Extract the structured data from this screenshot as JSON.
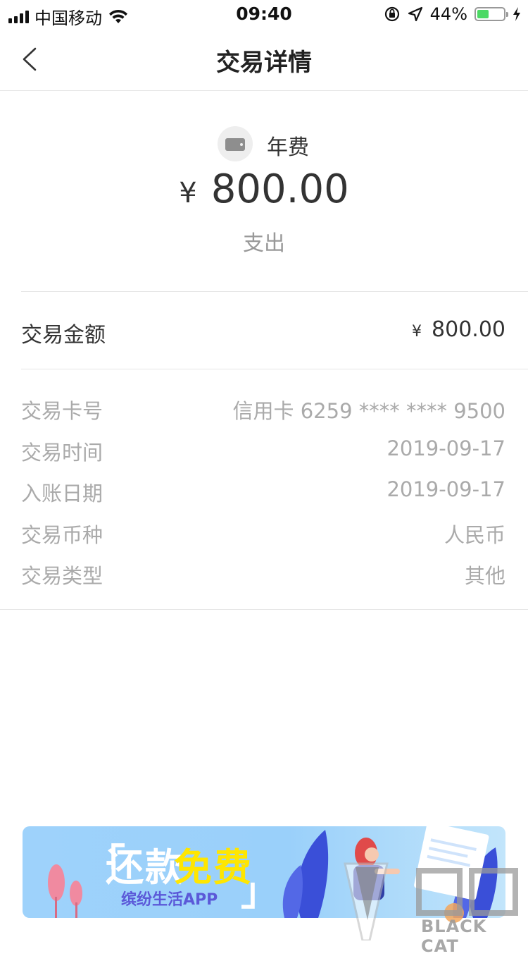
{
  "status_bar": {
    "carrier": "中国移动",
    "time": "09:40",
    "battery_percent": "44%",
    "battery_level": 0.44,
    "icons": [
      "signal-icon",
      "wifi-icon",
      "orientation-lock-icon",
      "location-icon",
      "battery-icon",
      "charging-icon"
    ]
  },
  "nav": {
    "title": "交易详情",
    "back_icon": "chevron-left-icon"
  },
  "summary": {
    "icon": "wallet-icon",
    "label": "年费",
    "currency_symbol": "¥",
    "amount": "800.00",
    "direction": "支出"
  },
  "amount_row": {
    "label": "交易金额",
    "currency_symbol": "¥",
    "value": "800.00"
  },
  "details": [
    {
      "label": "交易卡号",
      "value": "信用卡 6259 **** **** 9500"
    },
    {
      "label": "交易时间",
      "value": "2019-09-17"
    },
    {
      "label": "入账日期",
      "value": "2019-09-17"
    },
    {
      "label": "交易币种",
      "value": "人民币"
    },
    {
      "label": "交易类型",
      "value": "其他"
    }
  ],
  "banner": {
    "open_bracket": "「",
    "close_bracket": "」",
    "title_white": "还款",
    "title_yellow": "免费",
    "subtitle": "缤纷生活APP",
    "colors": {
      "background": "#9ed2fb",
      "highlight": "#ffe600",
      "subtitle": "#5b59d8"
    }
  },
  "watermark": {
    "text": "BLACK CAT"
  }
}
